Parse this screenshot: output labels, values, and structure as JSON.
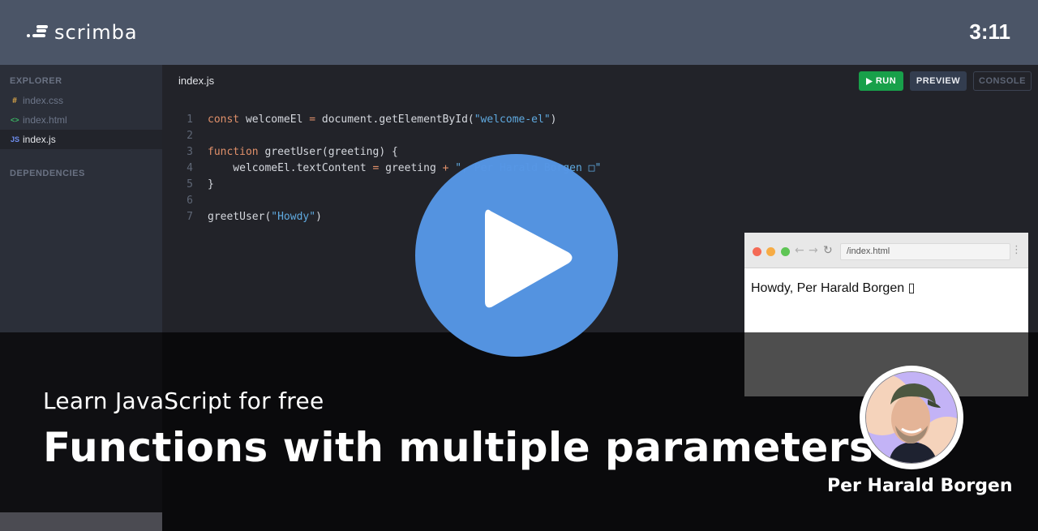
{
  "header": {
    "logo_text": "scrimba",
    "timer": "3:11"
  },
  "sidebar": {
    "explorer_heading": "EXPLORER",
    "files": [
      {
        "icon": "#",
        "icon_name": "css-hash-icon",
        "name": "index.css",
        "icon_color": "#e8b04a",
        "active": false
      },
      {
        "icon": "<>",
        "icon_name": "html-brackets-icon",
        "name": "index.html",
        "icon_color": "#3cb464",
        "active": false
      },
      {
        "icon": "JS",
        "icon_name": "js-icon",
        "name": "index.js",
        "icon_color": "#6f8ff0",
        "active": true
      }
    ],
    "dependencies_heading": "DEPENDENCIES"
  },
  "editor": {
    "active_tab": "index.js",
    "buttons": {
      "run": "RUN",
      "preview": "PREVIEW",
      "console": "CONSOLE"
    },
    "lines": [
      {
        "n": "1",
        "tokens": [
          [
            "kw",
            "const"
          ],
          [
            "id",
            " welcomeEl "
          ],
          [
            "op",
            "="
          ],
          [
            "id",
            " document.getElementById("
          ],
          [
            "str",
            "\"welcome-el\""
          ],
          [
            "id",
            ")"
          ]
        ]
      },
      {
        "n": "2",
        "tokens": []
      },
      {
        "n": "3",
        "tokens": [
          [
            "kw",
            "function"
          ],
          [
            "id",
            " greetUser(greeting) {"
          ]
        ]
      },
      {
        "n": "4",
        "tokens": [
          [
            "id",
            "    welcomeEl.textContent "
          ],
          [
            "op",
            "="
          ],
          [
            "id",
            " greeting "
          ],
          [
            "op",
            "+"
          ],
          [
            "str",
            " \", Per Harald Borgen □\""
          ]
        ]
      },
      {
        "n": "5",
        "tokens": [
          [
            "id",
            "}"
          ]
        ]
      },
      {
        "n": "6",
        "tokens": []
      },
      {
        "n": "7",
        "tokens": [
          [
            "id",
            "greetUser("
          ],
          [
            "str",
            "\"Howdy\""
          ],
          [
            "id",
            ")"
          ]
        ]
      }
    ]
  },
  "preview": {
    "url": "/index.html",
    "content": "Howdy, Per Harald Borgen ▯"
  },
  "overlay": {
    "course": "Learn JavaScript for free",
    "lesson_title": "Functions with multiple parameters",
    "author": "Per Harald Borgen"
  },
  "colors": {
    "header_bg": "#4b5567",
    "play_button": "#5696e4",
    "run_green": "#18a04a"
  }
}
